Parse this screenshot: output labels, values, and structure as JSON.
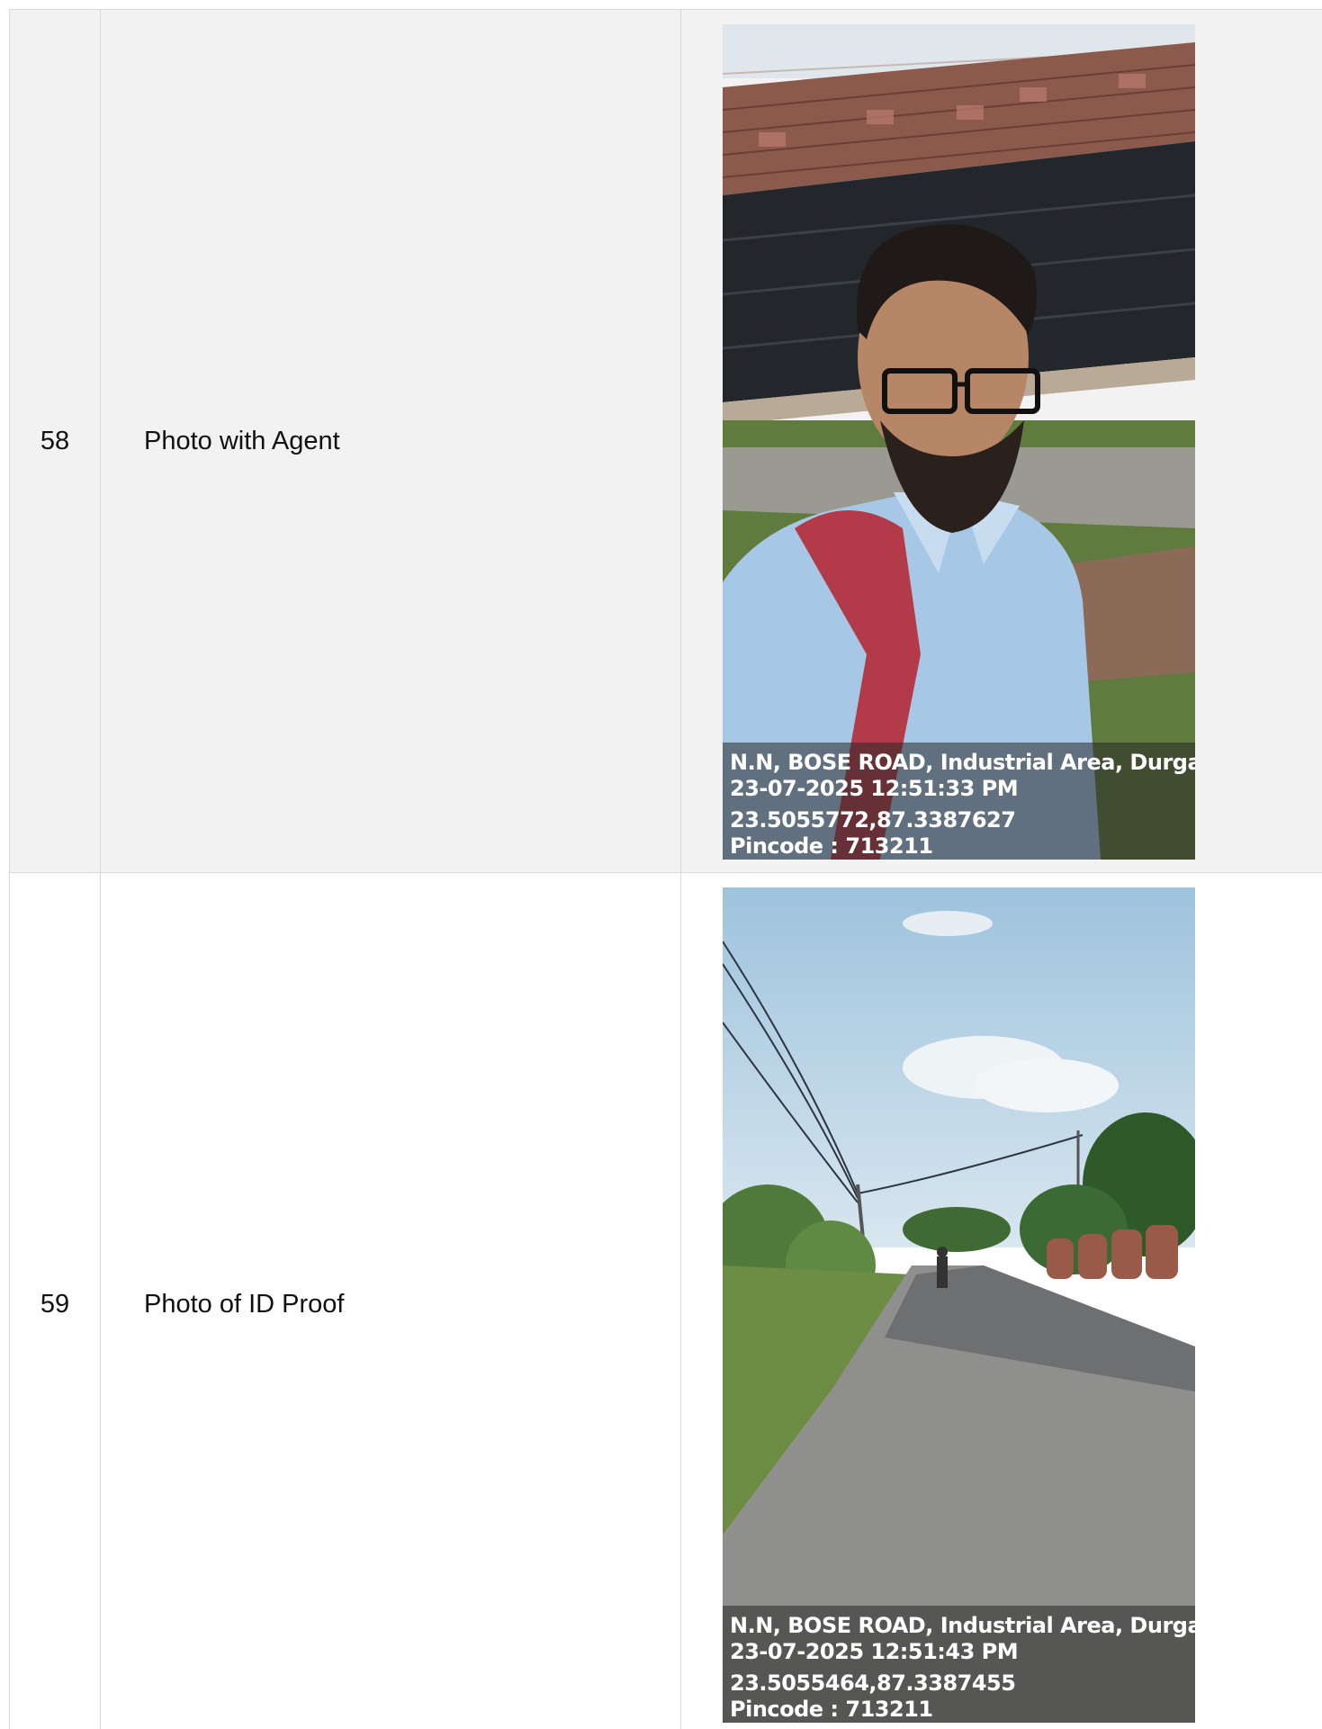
{
  "rows": [
    {
      "number": "58",
      "label": "Photo with Agent",
      "stamp": {
        "address": "N.N, BOSE ROAD, Industrial Area, Durgapur,",
        "datetime": "23-07-2025 12:51:33 PM",
        "coords": "23.5055772,87.3387627",
        "pincode": "Pincode : 713211"
      }
    },
    {
      "number": "59",
      "label": "Photo of ID Proof",
      "stamp": {
        "address": "N.N, BOSE ROAD, Industrial Area, Durgapur,",
        "datetime": "23-07-2025 12:51:43 PM",
        "coords": "23.5055464,87.3387455",
        "pincode": "Pincode : 713211"
      }
    }
  ],
  "colors": {
    "row_alt_background": "#f2f2f2",
    "border": "#d9d9d9"
  }
}
